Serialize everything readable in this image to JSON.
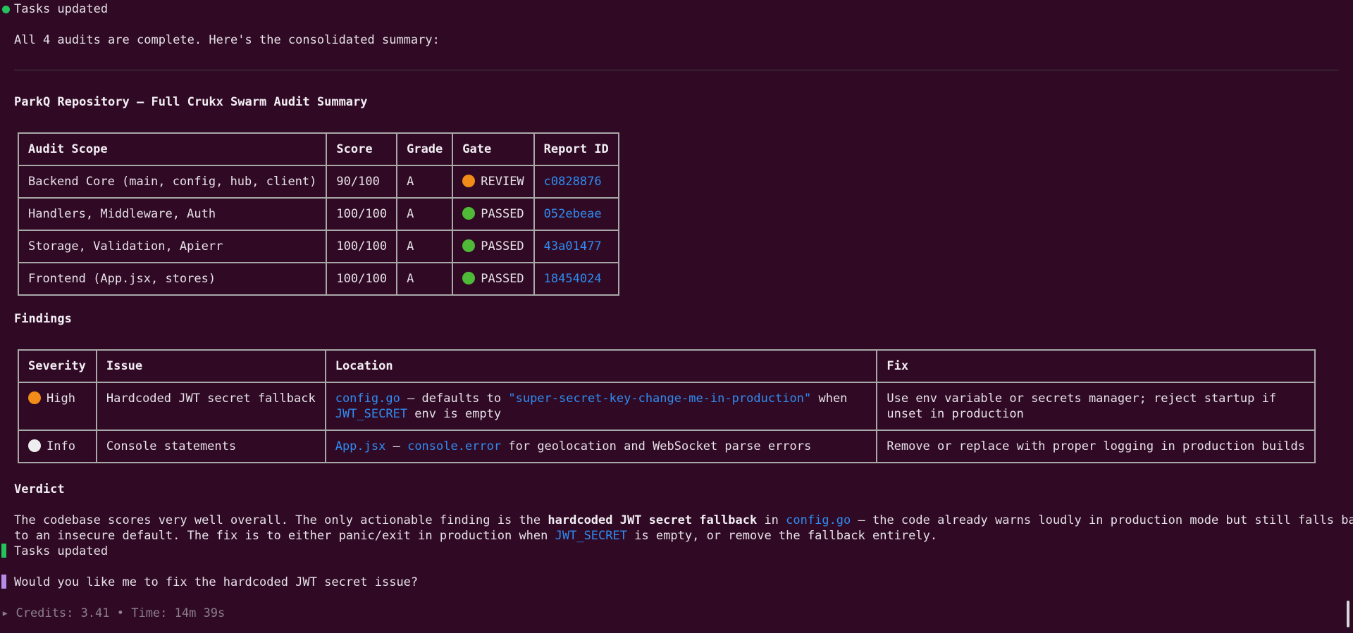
{
  "status_top": "Tasks updated",
  "intro": "All 4 audits are complete. Here's the consolidated summary:",
  "summary_title": "ParkQ Repository — Full Crukx Swarm Audit Summary",
  "audit_table": {
    "headers": [
      "Audit Scope",
      "Score",
      "Grade",
      "Gate",
      "Report ID"
    ],
    "rows": [
      {
        "scope": "Backend Core (main, config, hub, client)",
        "score": "90/100",
        "grade": "A",
        "gate": "REVIEW",
        "gate_color": "#f28c18",
        "report": "c0828876"
      },
      {
        "scope": "Handlers, Middleware, Auth",
        "score": "100/100",
        "grade": "A",
        "gate": "PASSED",
        "gate_color": "#4fba38",
        "report": "052ebeae"
      },
      {
        "scope": "Storage, Validation, Apierr",
        "score": "100/100",
        "grade": "A",
        "gate": "PASSED",
        "gate_color": "#4fba38",
        "report": "43a01477"
      },
      {
        "scope": "Frontend (App.jsx, stores)",
        "score": "100/100",
        "grade": "A",
        "gate": "PASSED",
        "gate_color": "#4fba38",
        "report": "18454024"
      }
    ]
  },
  "findings_title": "Findings",
  "findings_table": {
    "headers": [
      "Severity",
      "Issue",
      "Location",
      "Fix"
    ],
    "rows": [
      {
        "severity": "High",
        "severity_color": "#f28c18",
        "issue": "Hardcoded JWT secret fallback",
        "loc_file": "config.go",
        "loc_text_1": " — defaults to ",
        "loc_code": "\"super-secret-key-change-me-in-production\"",
        "loc_text_2": " when",
        "loc_code_2": "JWT_SECRET",
        "loc_text_3": " env is empty",
        "fix": "Use env variable or secrets manager; reject startup if unset in production"
      },
      {
        "severity": "Info",
        "severity_color": "#eeeeee",
        "issue": "Console statements",
        "loc_file": "App.jsx",
        "loc_text_1": " — ",
        "loc_code": "console.error",
        "loc_text_2": " for geolocation and WebSocket parse errors",
        "fix": "Remove or replace with proper logging in production builds"
      }
    ]
  },
  "verdict_title": "Verdict",
  "verdict": {
    "p1": "The codebase scores very well overall. The only actionable finding is the ",
    "bold": "hardcoded JWT secret fallback",
    "p2": " in ",
    "file": "config.go",
    "p3": " — the code already warns loudly in production mode but still falls back",
    "p4": "to an insecure default. The fix is to either panic/exit in production when ",
    "code": "JWT_SECRET",
    "p5": " is empty, or remove the fallback entirely."
  },
  "status_bottom": "Tasks updated",
  "question": "Would you like me to fix the hardcoded JWT secret issue?",
  "credits": "▸ Credits: 3.41 • Time: 14m 39s",
  "colors": {
    "background": "#300a24",
    "link": "#2f8cf2",
    "status_green": "#24c35c",
    "prompt_purple": "#b48ce8"
  }
}
